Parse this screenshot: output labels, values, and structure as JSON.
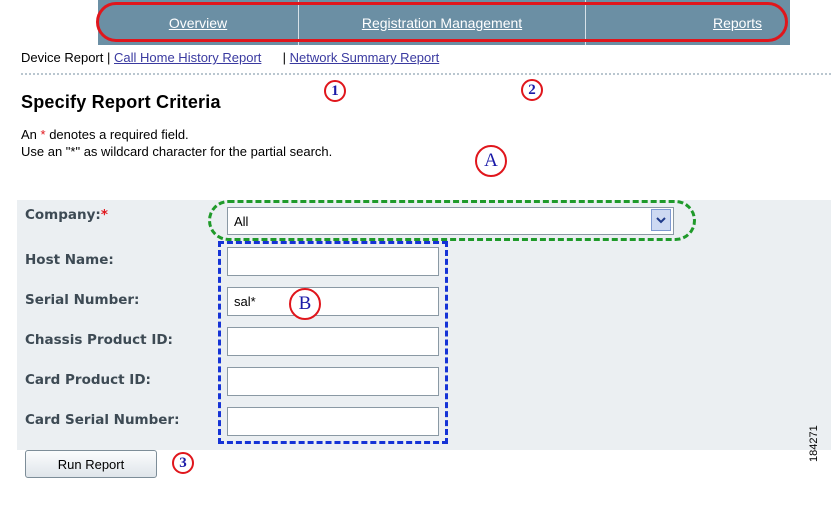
{
  "nav": {
    "items": [
      {
        "label": "Overview"
      },
      {
        "label": "Registration Management"
      },
      {
        "label": "Reports"
      }
    ]
  },
  "subnav": {
    "current": "Device Report",
    "sep": "|",
    "links": [
      "Call Home History Report",
      "Network Summary Report"
    ]
  },
  "callouts": {
    "one": "1",
    "two": "2",
    "three": "3",
    "a": "A",
    "b": "B"
  },
  "page": {
    "heading": "Specify Report Criteria",
    "note_prefix": "An ",
    "note_star": "*",
    "note_suffix": " denotes a required field.",
    "wildcard_note": "Use an \"*\" as wildcard character for the partial search."
  },
  "form": {
    "company_label": "Company:",
    "required_star": "*",
    "company_value": "All",
    "host_name_label": "Host Name:",
    "host_name_value": "",
    "serial_number_label": "Serial Number:",
    "serial_number_value": "sal*",
    "chassis_label": "Chassis Product ID:",
    "chassis_value": "",
    "card_product_label": "Card Product ID:",
    "card_product_value": "",
    "card_serial_label": "Card Serial Number:",
    "card_serial_value": ""
  },
  "actions": {
    "run_report": "Run Report"
  },
  "figure_id": "184271",
  "colors": {
    "nav_bg": "#6b8fa4",
    "callout_red": "#e0161c",
    "panel_bg": "#ebeff2",
    "link": "#3a3aa0"
  }
}
